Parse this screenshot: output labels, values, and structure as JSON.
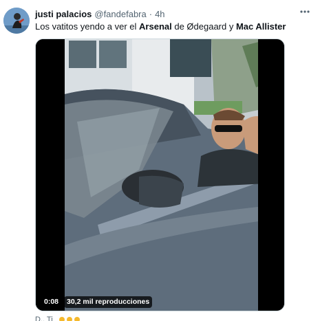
{
  "tweet": {
    "author_name": "justi palacios",
    "author_handle": "@fandefabra",
    "separator": "·",
    "timestamp": "4h",
    "text_parts": {
      "p1": "Los vatitos yendo a ver el ",
      "b1": "Arsenal",
      "p2": " de Ødegaard y ",
      "b2": "Mac Allister"
    }
  },
  "video": {
    "current_time": "0:08",
    "views_label": "30,2 mil reproducciones"
  },
  "footer": {
    "reply_preview": "D.. Ti"
  },
  "icons": {
    "more": "more-horizontal-icon",
    "avatar": "avatar-image"
  },
  "colors": {
    "text_primary": "#0f1419",
    "text_secondary": "#536471",
    "border": "#cfd9de"
  }
}
